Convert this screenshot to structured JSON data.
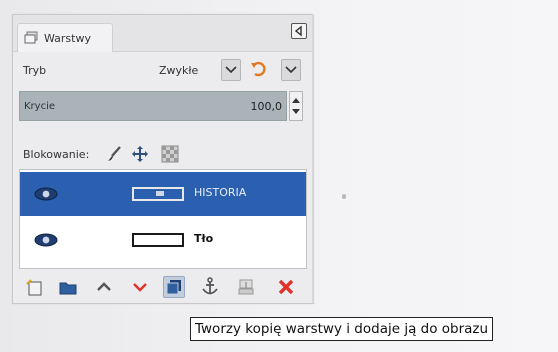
{
  "panel": {
    "tab_label": "Warstwy",
    "mode": {
      "label": "Tryb",
      "value": "Zwykłe"
    },
    "opacity": {
      "label": "Krycie",
      "value": "100,0"
    },
    "lock": {
      "label": "Blokowanie:"
    },
    "layers": [
      {
        "name": "HISTORIA",
        "selected": true
      },
      {
        "name": "Tło",
        "selected": false
      }
    ]
  },
  "tooltip": "Tworzy kopię warstwy i dodaje ją do obrazu",
  "colors": {
    "selected_row": "#2b5fb0",
    "opacity_bar": "#a9b3b8",
    "delete_red": "#e0312b",
    "reset_orange": "#e07a22"
  },
  "icons": [
    "layers-tab-icon",
    "tab-menu-icon",
    "chevron-down-icon",
    "reset-mode-icon",
    "paintbrush-icon",
    "move-icon",
    "alpha-lock-icon",
    "eye-icon",
    "new-layer-icon",
    "new-group-icon",
    "raise-layer-icon",
    "lower-layer-icon",
    "duplicate-layer-icon",
    "anchor-icon",
    "merge-layer-icon",
    "delete-icon"
  ]
}
